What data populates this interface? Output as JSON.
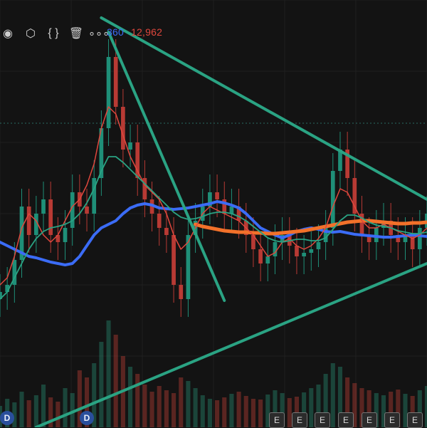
{
  "toolbar": {
    "icons": [
      "eye-icon",
      "gear-icon",
      "code-braces-icon",
      "trash-icon",
      "more-icon"
    ],
    "glyphs": [
      "◉",
      "⬡",
      "{ }",
      "🗑",
      "∘∘∘"
    ]
  },
  "legend": {
    "value_blue": "360",
    "value_red": "12,962",
    "color_blue": "#3b6cf6",
    "color_red": "#e0473d"
  },
  "markers": {
    "dividends": [
      "D",
      "D"
    ],
    "earnings": [
      "E",
      "E",
      "E",
      "E",
      "E",
      "E",
      "E"
    ]
  },
  "chart_data": {
    "type": "line",
    "x": [
      0,
      1,
      2,
      3,
      4,
      5,
      6,
      7,
      8,
      9,
      10,
      11,
      12,
      13,
      14,
      15,
      16,
      17,
      18,
      19,
      20,
      21,
      22,
      23,
      24,
      25,
      26,
      27,
      28,
      29,
      30,
      31,
      32,
      33,
      34,
      35,
      36,
      37,
      38,
      39,
      40,
      41,
      42,
      43,
      44,
      45,
      46,
      47,
      48,
      49,
      50,
      51,
      52,
      53,
      54,
      55,
      56,
      57,
      58,
      59
    ],
    "price_close": [
      410,
      400,
      365,
      290,
      330,
      300,
      280,
      330,
      340,
      320,
      270,
      290,
      300,
      250,
      180,
      80,
      150,
      210,
      200,
      250,
      280,
      300,
      320,
      330,
      400,
      420,
      330,
      310,
      290,
      270,
      280,
      300,
      290,
      310,
      330,
      350,
      370,
      360,
      340,
      330,
      345,
      360,
      355,
      350,
      340,
      320,
      240,
      210,
      250,
      300,
      330,
      340,
      320,
      310,
      330,
      340,
      330,
      350,
      320,
      300
    ],
    "volume": [
      30,
      40,
      35,
      50,
      38,
      45,
      60,
      42,
      36,
      55,
      48,
      80,
      70,
      90,
      120,
      150,
      130,
      100,
      85,
      75,
      60,
      50,
      58,
      52,
      48,
      70,
      65,
      55,
      45,
      40,
      38,
      42,
      47,
      50,
      44,
      40,
      39,
      46,
      52,
      48,
      41,
      43,
      49,
      55,
      60,
      75,
      90,
      85,
      70,
      62,
      55,
      52,
      48,
      45,
      50,
      53,
      47,
      44,
      52,
      58
    ],
    "series": [
      {
        "name": "",
        "color": "#3b6cf6",
        "values": [
          340,
          345,
          350,
          355,
          360,
          362,
          365,
          368,
          370,
          372,
          370,
          360,
          345,
          330,
          320,
          315,
          310,
          300,
          292,
          288,
          286,
          288,
          292,
          293,
          294,
          293,
          292,
          290,
          288,
          286,
          283,
          285,
          288,
          292,
          300,
          310,
          320,
          325,
          330,
          334,
          330,
          325,
          322,
          320,
          322,
          325,
          326,
          325,
          327,
          329,
          330,
          331,
          332,
          333,
          333,
          332,
          331,
          330,
          331,
          332
        ]
      },
      {
        "name": "",
        "color": "#f2712a",
        "values": [
          null,
          null,
          null,
          null,
          null,
          null,
          null,
          null,
          null,
          null,
          null,
          null,
          null,
          null,
          null,
          null,
          null,
          null,
          null,
          null,
          null,
          null,
          null,
          null,
          null,
          null,
          null,
          315,
          318,
          320,
          322,
          324,
          325,
          326,
          326,
          327,
          327,
          328,
          328,
          327,
          326,
          325,
          324,
          322,
          320,
          318,
          316,
          314,
          312,
          311,
          310,
          310,
          311,
          312,
          313,
          314,
          314,
          313,
          313,
          312
        ]
      },
      {
        "name": "",
        "color": "#e0473d",
        "values": [
          400,
          390,
          360,
          320,
          300,
          310,
          330,
          340,
          330,
          310,
          290,
          280,
          260,
          230,
          180,
          150,
          160,
          190,
          220,
          240,
          260,
          270,
          280,
          300,
          330,
          350,
          340,
          320,
          300,
          290,
          295,
          300,
          305,
          310,
          320,
          330,
          345,
          360,
          355,
          340,
          335,
          345,
          350,
          345,
          335,
          320,
          290,
          265,
          270,
          290,
          310,
          320,
          320,
          315,
          320,
          325,
          330,
          335,
          330,
          320
        ]
      },
      {
        "name": "",
        "color": "#2aa383",
        "values": [
          420,
          410,
          390,
          370,
          350,
          335,
          325,
          320,
          318,
          315,
          310,
          300,
          285,
          265,
          240,
          220,
          220,
          228,
          238,
          248,
          258,
          268,
          278,
          288,
          298,
          305,
          308,
          307,
          304,
          300,
          298,
          298,
          300,
          304,
          310,
          318,
          326,
          334,
          338,
          340,
          338,
          336,
          336,
          338,
          338,
          334,
          322,
          310,
          302,
          302,
          306,
          312,
          316,
          318,
          320,
          324,
          326,
          328,
          328,
          326
        ]
      }
    ],
    "trendlines": [
      {
        "name": "",
        "color": "#2aa383",
        "points": [
          [
            5,
            600
          ],
          [
            59,
            370
          ]
        ]
      },
      {
        "name": "",
        "color": "#2aa383",
        "points": [
          [
            14,
            25
          ],
          [
            59,
            280
          ]
        ]
      },
      {
        "name": "",
        "color": "#2aa383",
        "points": [
          [
            15,
            45
          ],
          [
            31,
            422
          ]
        ]
      }
    ],
    "xlim": [
      0,
      59
    ],
    "ylim": [
      0,
      600
    ],
    "grid": true
  }
}
